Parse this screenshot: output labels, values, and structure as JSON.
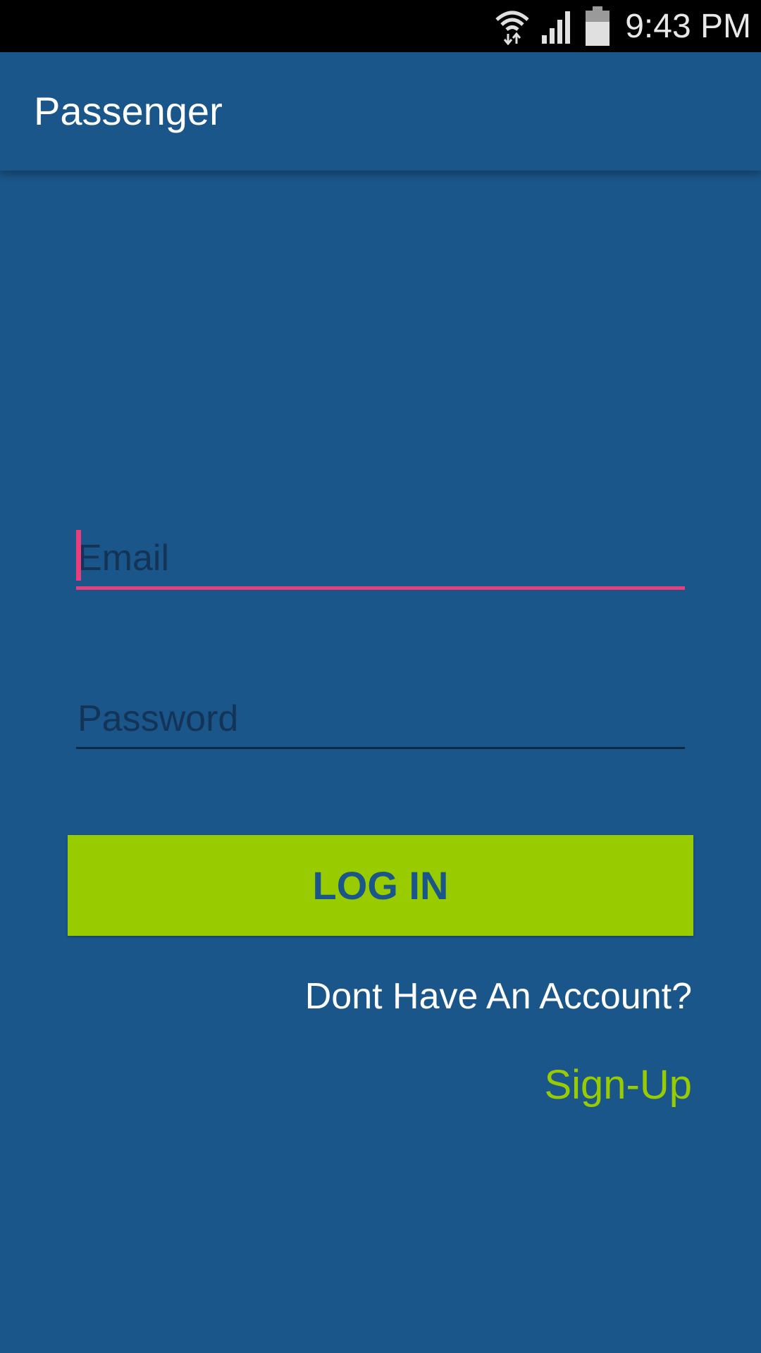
{
  "status_bar": {
    "time": "9:43 PM",
    "icons": [
      "wifi-icon",
      "cell-signal-icon",
      "battery-icon"
    ]
  },
  "app_bar": {
    "title": "Passenger"
  },
  "form": {
    "email_placeholder": "Email",
    "email_value": "",
    "password_placeholder": "Password",
    "password_value": "",
    "login_label": "LOG IN",
    "account_prompt": "Dont Have An Account?",
    "signup_label": "Sign-Up"
  },
  "colors": {
    "background": "#1a5689",
    "accent_green": "#99cc00",
    "focus_pink": "#e93d7c",
    "status_bar": "#000000"
  }
}
